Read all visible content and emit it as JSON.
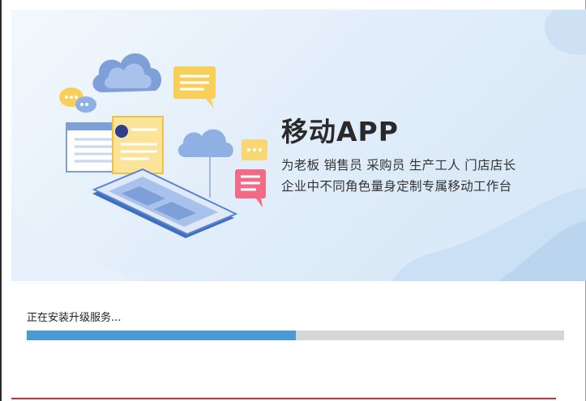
{
  "banner": {
    "headline": "移动APP",
    "tagline_line1": "为老板 销售员 采购员 生产工人 门店店长",
    "tagline_line2": "企业中不同角色量身定制专属移动工作台",
    "illustration": [
      "cloud-icon",
      "chat-bubble-icon",
      "phone-icon",
      "document-icon"
    ]
  },
  "install": {
    "status": "正在安装升级服务...",
    "progress_fraction": 0.5
  },
  "colors": {
    "progress": "#4a9ad6",
    "track": "#d6d6d6",
    "banner_bg": "#e2eefa",
    "bottom_accent": "#c8323c"
  }
}
